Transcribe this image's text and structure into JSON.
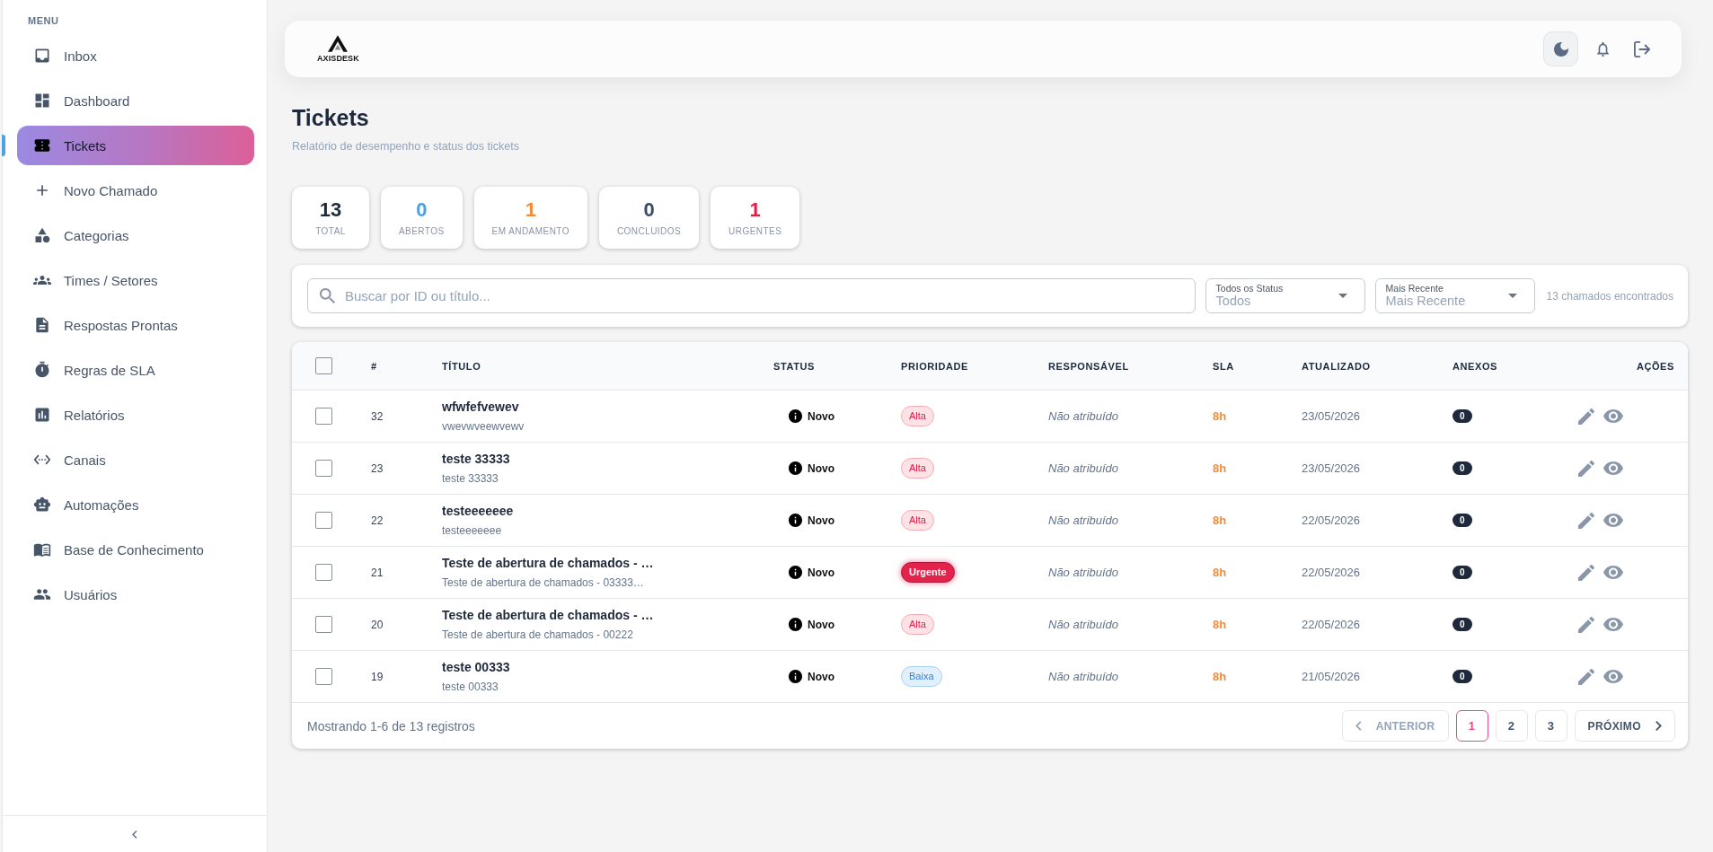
{
  "sidebar": {
    "heading": "MENU",
    "items": [
      {
        "label": "Inbox",
        "selected": false
      },
      {
        "label": "Dashboard",
        "selected": false
      },
      {
        "label": "Tickets",
        "selected": true
      },
      {
        "label": "Novo Chamado",
        "selected": false
      },
      {
        "label": "Categorias",
        "selected": false
      },
      {
        "label": "Times / Setores",
        "selected": false
      },
      {
        "label": "Respostas Prontas",
        "selected": false
      },
      {
        "label": "Regras de SLA",
        "selected": false
      },
      {
        "label": "Relatórios",
        "selected": false
      },
      {
        "label": "Canais",
        "selected": false
      },
      {
        "label": "Automações",
        "selected": false
      },
      {
        "label": "Base de Conhecimento",
        "selected": false
      },
      {
        "label": "Usuários",
        "selected": false
      }
    ]
  },
  "header": {
    "logo_text": "AXISDESK"
  },
  "page": {
    "title": "Tickets",
    "subtitle": "Relatório de desempenho e status dos tickets"
  },
  "stats": [
    {
      "value": "13",
      "label": "TOTAL",
      "color": "#1e293b"
    },
    {
      "value": "0",
      "label": "ABERTOS",
      "color": "#4ba3e3"
    },
    {
      "value": "1",
      "label": "EM ANDAMENTO",
      "color": "#f28c38"
    },
    {
      "value": "0",
      "label": "CONCLUIDOS",
      "color": "#3b4d66"
    },
    {
      "value": "1",
      "label": "URGENTES",
      "color": "#e11d48"
    }
  ],
  "filters": {
    "search": {
      "placeholder": "Buscar por ID ou título..."
    },
    "selects": [
      {
        "label": "Todos os Status",
        "value": "Todos"
      },
      {
        "label": "Mais Recente",
        "value": "Mais Recente"
      }
    ],
    "result_count": "13 chamados encontrados"
  },
  "table": {
    "select_all": {
      "checked": false
    },
    "columns": [
      "#",
      "TÍTULO",
      "STATUS",
      "PRIORIDADE",
      "RESPONSÁVEL",
      "SLA",
      "ATUALIZADO",
      "ANEXOS",
      "AÇÕES"
    ],
    "rows": [
      {
        "checked": false,
        "id": "32",
        "title": "wfwfefvewev",
        "description": "vwevwveewvewv",
        "status": "Novo",
        "priority": {
          "label": "Alta",
          "kind": "high"
        },
        "assignee": "Não atribuído",
        "sla": "8h",
        "updated": "23/05/2026",
        "attachments": "0"
      },
      {
        "checked": false,
        "id": "23",
        "title": "teste 33333",
        "description": "teste 33333",
        "status": "Novo",
        "priority": {
          "label": "Alta",
          "kind": "high"
        },
        "assignee": "Não atribuído",
        "sla": "8h",
        "updated": "23/05/2026",
        "attachments": "0"
      },
      {
        "checked": false,
        "id": "22",
        "title": "testeeeeeee",
        "description": "testeeeeeee",
        "status": "Novo",
        "priority": {
          "label": "Alta",
          "kind": "high"
        },
        "assignee": "Não atribuído",
        "sla": "8h",
        "updated": "22/05/2026",
        "attachments": "0"
      },
      {
        "checked": false,
        "id": "21",
        "title": "Teste de abertura de chamados - …",
        "description": "Teste de abertura de chamados - 03333…",
        "status": "Novo",
        "priority": {
          "label": "Urgente",
          "kind": "urgent"
        },
        "assignee": "Não atribuído",
        "sla": "8h",
        "updated": "22/05/2026",
        "attachments": "0"
      },
      {
        "checked": false,
        "id": "20",
        "title": "Teste de abertura de chamados - …",
        "description": "Teste de abertura de chamados - 00222",
        "status": "Novo",
        "priority": {
          "label": "Alta",
          "kind": "high"
        },
        "assignee": "Não atribuído",
        "sla": "8h",
        "updated": "22/05/2026",
        "attachments": "0"
      },
      {
        "checked": false,
        "id": "19",
        "title": "teste 00333",
        "description": "teste 00333",
        "status": "Novo",
        "priority": {
          "label": "Baixa",
          "kind": "low"
        },
        "assignee": "Não atribuído",
        "sla": "8h",
        "updated": "21/05/2026",
        "attachments": "0"
      }
    ]
  },
  "pagination": {
    "summary": "Mostrando 1-6 de 13 registros",
    "previous": {
      "label": "ANTERIOR",
      "disabled": true
    },
    "pages": [
      {
        "label": "1",
        "selected": true
      },
      {
        "label": "2",
        "selected": false
      },
      {
        "label": "3",
        "selected": false
      }
    ],
    "next": {
      "label": "PRÓXIMO",
      "disabled": false
    }
  }
}
